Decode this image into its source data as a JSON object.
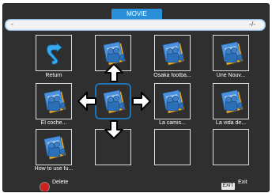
{
  "header": {
    "title": "MOVIE"
  },
  "path_bar": {
    "path": "-",
    "page": "-/-"
  },
  "items": [
    {
      "label": "Return",
      "icon": "return-arrow-icon"
    },
    {
      "label": "",
      "icon": "movie-file-icon"
    },
    {
      "label": "Osaka footba...",
      "icon": "movie-file-icon"
    },
    {
      "label": "Une Nouv...",
      "icon": "movie-file-icon"
    },
    {
      "label": "El coche...",
      "icon": "movie-file-icon"
    },
    {
      "label": "",
      "icon": "movie-file-icon"
    },
    {
      "label": "La camis...",
      "icon": "movie-file-icon"
    },
    {
      "label": "La vida de...",
      "icon": "movie-file-icon"
    },
    {
      "label": "How to use fu...",
      "icon": "movie-file-icon"
    }
  ],
  "footer": {
    "delete_label": "Delete",
    "exit_key": "EXIT",
    "exit_label": "Exit"
  },
  "colors": {
    "accent": "#2a8fd9",
    "focus": "#1f73b4",
    "delete": "#d21f1f",
    "background": "#2f2f2f"
  }
}
